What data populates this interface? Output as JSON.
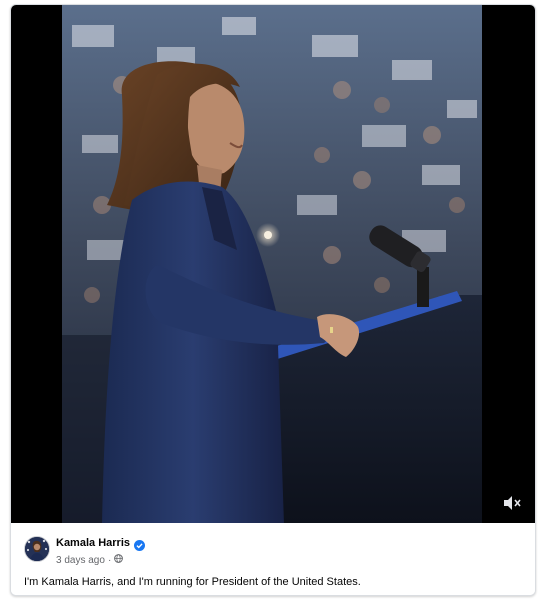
{
  "post": {
    "author_name": "Kamala Harris",
    "verified": true,
    "timestamp": "3 days ago",
    "separator": "·",
    "privacy": "globe-icon",
    "caption": "I'm Kamala Harris, and I'm running for President of the United States."
  },
  "video": {
    "muted": true,
    "control_icon": "muted-speaker-icon"
  },
  "colors": {
    "verified_badge": "#1877f2",
    "meta_text": "#65676b",
    "text": "#050505",
    "border": "#dadde1"
  }
}
